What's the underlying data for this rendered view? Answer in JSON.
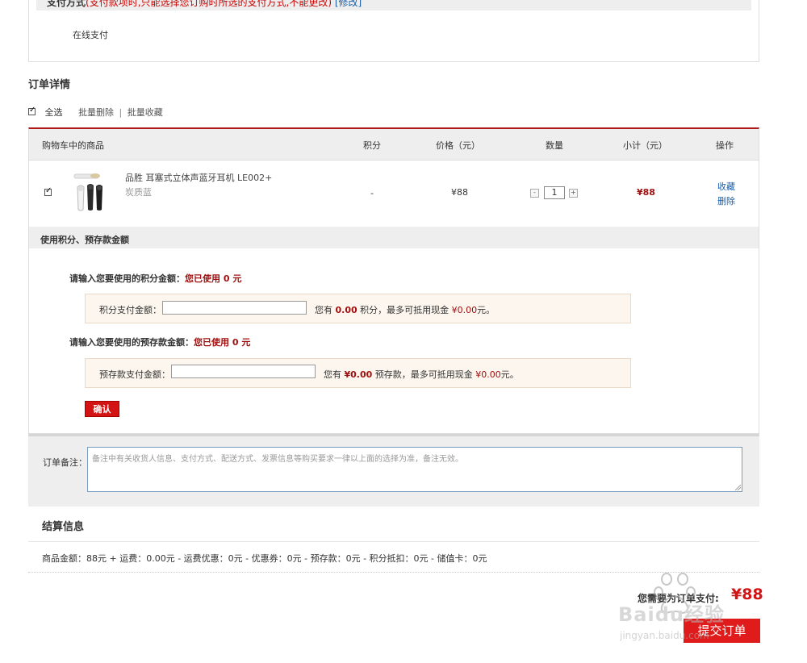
{
  "payment": {
    "header_title": "支付方式",
    "header_note": "(支付款项时,只能选择您订购时所选的支付方式,不能更改)",
    "header_link": "[修改]",
    "method": "在线支付"
  },
  "order": {
    "title": "订单详情",
    "select_all": "全选",
    "batch_delete": "批量删除",
    "separator": "|",
    "batch_favorite": "批量收藏",
    "columns": [
      "购物车中的商品",
      "积分",
      "价格（元）",
      "数量",
      "小计（元）",
      "操作"
    ],
    "items": [
      {
        "name": "品胜 耳塞式立体声蓝牙耳机 LE002+",
        "color": "炭质蓝",
        "points": "-",
        "price": "¥88",
        "quantity": "1",
        "subtotal": "¥88",
        "action_favorite": "收藏",
        "action_delete": "删除",
        "qty_minus": "-",
        "qty_plus": "+"
      }
    ]
  },
  "credits": {
    "section_title": "使用积分、预存款金额",
    "points_prompt": "请输入您要使用的积分金额：",
    "points_used": "您已使用 0 元",
    "points_field_label": "积分支付金额：",
    "points_info_1": "您有",
    "points_info_value": "0.00",
    "points_info_2": "积分，最多可抵用现金",
    "points_info_cash": "¥0.00",
    "points_info_3": "元。",
    "deposit_prompt": "请输入您要使用的预存款金额：",
    "deposit_used": "您已使用 0 元",
    "deposit_field_label": "预存款支付金额：",
    "deposit_info_1": "您有",
    "deposit_info_value": "¥0.00",
    "deposit_info_2": "预存款，最多可抵用现金",
    "deposit_info_cash": "¥0.00",
    "deposit_info_3": "元。",
    "confirm_label": "确认"
  },
  "remark": {
    "label": "订单备注：",
    "placeholder": "备注中有关收货人信息、支付方式、配送方式、发票信息等购买要求一律以上面的选择为准，备注无效。"
  },
  "settlement": {
    "title": "结算信息",
    "summary": "商品金额：88元 + 运费：0.00元 - 运费优惠：0元 - 优惠券：0元 - 预存款：0元 - 积分抵扣：0元 - 储值卡：0元",
    "pay_label": "您需要为订单支付:",
    "pay_total": "¥88",
    "submit_label": "提交订单"
  },
  "watermark": {
    "brand": "Baidu经验",
    "url": "jingyan.baidu.com"
  },
  "colors": {
    "accent_red": "#d31414",
    "table_top_border": "#b01818",
    "link_blue": "#1a5ea8"
  },
  "icons": [
    "checkbox-checked-icon",
    "resize-grip-icon",
    "baidu-paw-icon"
  ]
}
